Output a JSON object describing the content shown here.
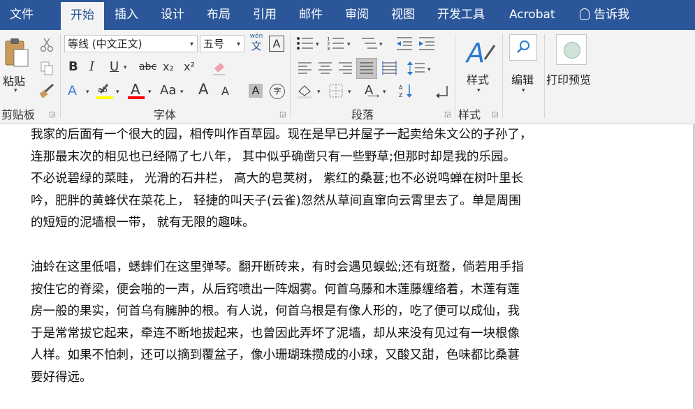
{
  "tabs": [
    {
      "label": "文件"
    },
    {
      "label": "开始"
    },
    {
      "label": "插入"
    },
    {
      "label": "设计"
    },
    {
      "label": "布局"
    },
    {
      "label": "引用"
    },
    {
      "label": "邮件"
    },
    {
      "label": "审阅"
    },
    {
      "label": "视图"
    },
    {
      "label": "开发工具"
    },
    {
      "label": "Acrobat"
    }
  ],
  "tell_me": "告诉我",
  "clipboard": {
    "paste_label": "粘贴",
    "group_label": "剪贴板"
  },
  "font": {
    "family": "等线 (中文正文)",
    "size": "五号",
    "wen_top": "wén",
    "wen_bottom": "文",
    "a_box": "A",
    "bold": "B",
    "italic": "I",
    "underline": "U",
    "strike": "abc",
    "sub": "x₂",
    "sup": "x²",
    "aa": "Aa",
    "grow": "A",
    "shrink": "A",
    "char_shade": "A",
    "enclose": "字",
    "group_label": "字体"
  },
  "paragraph": {
    "group_label": "段落"
  },
  "styles": {
    "label": "样式",
    "group_label": "样式"
  },
  "editing": {
    "label": "编辑"
  },
  "print_preview": {
    "label": "打印预览"
  },
  "colors": {
    "tabbar": "#2b579a",
    "highlight": "#ffff00",
    "font_color": "#ff0000"
  },
  "document": {
    "paragraphs": [
      [
        "我家的后面有一个很大的园，相传叫作百草园。现在是早已并屋子一起卖给朱文公的子孙了，",
        "连那最末次的相见也已经隔了七八年， 其中似乎确凿只有一些野草;但那时却是我的乐园。",
        "不必说碧绿的菜畦， 光滑的石井栏， 高大的皂荚树， 紫红的桑葚;也不必说鸣蝉在树叶里长",
        "吟，肥胖的黄蜂伏在菜花上， 轻捷的叫天子(云雀)忽然从草间直窜向云霄里去了。单是周围",
        "的短短的泥墙根一带， 就有无限的趣味。"
      ],
      [
        "油蛉在这里低唱，蟋蟀们在这里弹琴。翻开断砖来，有时会遇见蜈蚣;还有斑蝥，倘若用手指",
        "按住它的脊梁，便会啪的一声，从后窍喷出一阵烟雾。何首乌藤和木莲藤缠络着，木莲有莲",
        "房一般的果实，何首乌有臃肿的根。有人说，何首乌根是有像人形的，吃了便可以成仙，我",
        "于是常常拔它起来，牵连不断地拔起来，也曾因此弄坏了泥墙，却从来没有见过有一块根像",
        "人样。如果不怕刺，还可以摘到覆盆子，像小珊瑚珠攒成的小球，又酸又甜，色味都比桑葚",
        "要好得远。"
      ]
    ]
  }
}
